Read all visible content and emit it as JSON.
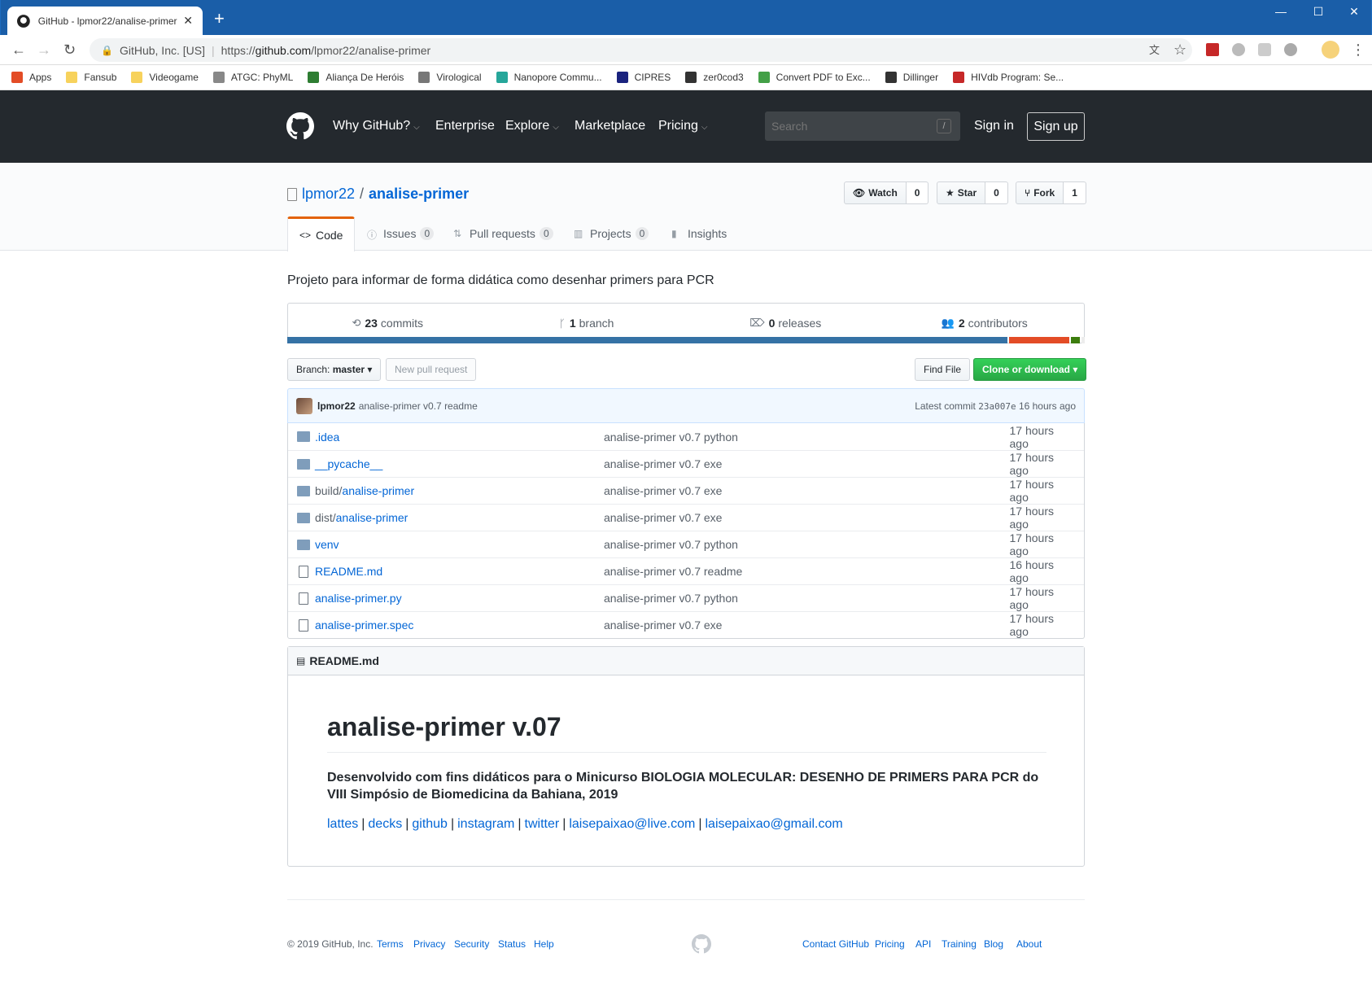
{
  "browser": {
    "tab_title": "GitHub - lpmor22/analise-primer",
    "new_tab": "+",
    "org": "GitHub, Inc. [US]",
    "url_prefix": "https://",
    "url_host": "github.com",
    "url_path": "/lpmor22/analise-primer",
    "bookmarks": [
      {
        "label": "Apps",
        "color": "#e34c26"
      },
      {
        "label": "Fansub",
        "color": "#f7d25c"
      },
      {
        "label": "Videogame",
        "color": "#f7d25c"
      },
      {
        "label": "ATGC: PhyML",
        "color": "#888888"
      },
      {
        "label": "Aliança De Heróis",
        "color": "#2e7d32"
      },
      {
        "label": "Virological",
        "color": "#777777"
      },
      {
        "label": "Nanopore Commu...",
        "color": "#26a69a"
      },
      {
        "label": "CIPRES",
        "color": "#1a237e"
      },
      {
        "label": "zer0cod3",
        "color": "#333333"
      },
      {
        "label": "Convert PDF to Exc...",
        "color": "#43a047"
      },
      {
        "label": "Dillinger",
        "color": "#333333"
      },
      {
        "label": "HIVdb Program: Se...",
        "color": "#c62828"
      }
    ]
  },
  "gh_header": {
    "nav": [
      "Why GitHub?",
      "Enterprise",
      "Explore",
      "Marketplace",
      "Pricing"
    ],
    "search_placeholder": "Search",
    "search_key": "/",
    "sign_in": "Sign in",
    "sign_up": "Sign up"
  },
  "repo": {
    "owner": "lpmor22",
    "name": "analise-primer",
    "watch_label": "Watch",
    "watch_count": "0",
    "star_label": "Star",
    "star_count": "0",
    "fork_label": "Fork",
    "fork_count": "1",
    "tabs": [
      {
        "label": "Code",
        "counter": ""
      },
      {
        "label": "Issues",
        "counter": "0"
      },
      {
        "label": "Pull requests",
        "counter": "0"
      },
      {
        "label": "Projects",
        "counter": "0"
      },
      {
        "label": "Insights",
        "counter": ""
      }
    ],
    "description": "Projeto para informar de forma didática como desenhar primers para PCR",
    "summary": {
      "commits_num": "23",
      "commits_label": "commits",
      "branch_num": "1",
      "branch_label": "branch",
      "releases_num": "0",
      "releases_label": "releases",
      "contributors_num": "2",
      "contributors_label": "contributors"
    },
    "lang_colors": [
      "#3572A5",
      "#e34c26",
      "#3c7d0e"
    ],
    "lang_share": [
      0.903,
      0.076,
      0.011
    ],
    "branch_label": "Branch:",
    "branch_value": "master",
    "new_pr": "New pull request",
    "find_file": "Find File",
    "clone": "Clone or download",
    "commit": {
      "author": "lpmor22",
      "message": "analise-primer v0.7 readme",
      "latest_label": "Latest commit",
      "sha": "23a007e",
      "age": "16 hours ago"
    },
    "files": [
      {
        "type": "folder",
        "prefix": "",
        "name": ".idea",
        "msg": "analise-primer v0.7 python",
        "age": "17 hours ago"
      },
      {
        "type": "folder",
        "prefix": "",
        "name": "__pycache__",
        "msg": "analise-primer v0.7 exe",
        "age": "17 hours ago"
      },
      {
        "type": "folder",
        "prefix": "build/",
        "name": "analise-primer",
        "msg": "analise-primer v0.7 exe",
        "age": "17 hours ago"
      },
      {
        "type": "folder",
        "prefix": "dist/",
        "name": "analise-primer",
        "msg": "analise-primer v0.7 exe",
        "age": "17 hours ago"
      },
      {
        "type": "folder",
        "prefix": "",
        "name": "venv",
        "msg": "analise-primer v0.7 python",
        "age": "17 hours ago"
      },
      {
        "type": "file",
        "prefix": "",
        "name": "README.md",
        "msg": "analise-primer v0.7 readme",
        "age": "16 hours ago"
      },
      {
        "type": "file",
        "prefix": "",
        "name": "analise-primer.py",
        "msg": "analise-primer v0.7 python",
        "age": "17 hours ago"
      },
      {
        "type": "file",
        "prefix": "",
        "name": "analise-primer.spec",
        "msg": "analise-primer v0.7 exe",
        "age": "17 hours ago"
      }
    ]
  },
  "readme": {
    "header": "README.md",
    "title": "analise-primer v.07",
    "subtitle": "Desenvolvido com fins didáticos para o Minicurso BIOLOGIA MOLECULAR: DESENHO DE PRIMERS PARA PCR do VIII Simpósio de Biomedicina da Bahiana, 2019",
    "links": [
      "lattes",
      "decks",
      "github",
      "instagram",
      "twitter",
      "laisepaixao@live.com",
      "laisepaixao@gmail.com"
    ],
    "separator": "|"
  },
  "footer": {
    "copyright": "© 2019 GitHub, Inc.",
    "left_links": [
      "Terms",
      "Privacy",
      "Security",
      "Status",
      "Help"
    ],
    "right_links": [
      "Contact GitHub",
      "Pricing",
      "API",
      "Training",
      "Blog",
      "About"
    ]
  }
}
